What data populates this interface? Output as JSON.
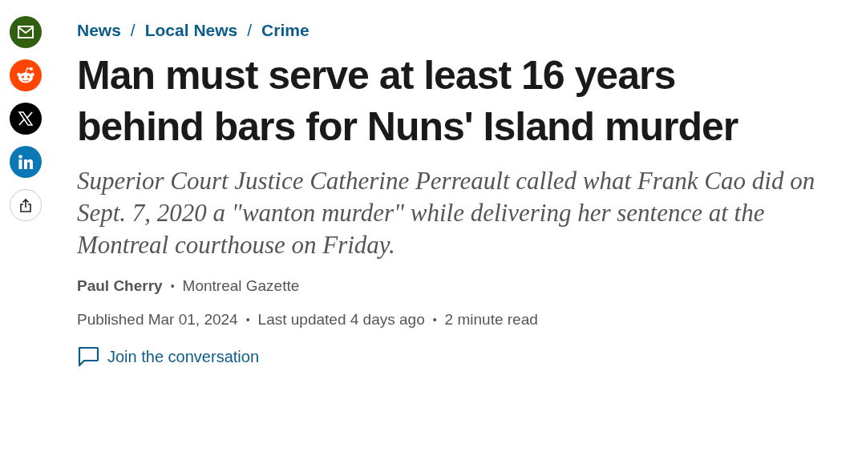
{
  "share_buttons": [
    {
      "kind": "email",
      "color": "#2f5f0f"
    },
    {
      "kind": "reddit",
      "color": "#ff4500"
    },
    {
      "kind": "x",
      "color": "#000000"
    },
    {
      "kind": "linkedin",
      "color": "#0a78b5"
    },
    {
      "kind": "share",
      "color": "#ffffff"
    }
  ],
  "breadcrumbs": [
    "News",
    "Local News",
    "Crime"
  ],
  "breadcrumb_separator": "/",
  "headline": "Man must serve at least 16 years behind bars for Nuns' Island murder",
  "subtitle": "Superior Court Justice Catherine Perreault called what Frank Cao did on Sept. 7, 2020 a \"wanton murder\" while delivering her sentence at the Montreal courthouse on Friday.",
  "byline": {
    "author": "Paul Cherry",
    "source": "Montreal Gazette"
  },
  "meta": [
    "Published Mar 01, 2024",
    "Last updated 4 days ago",
    "2 minute read"
  ],
  "separator": "•",
  "comments_link": "Join the conversation"
}
